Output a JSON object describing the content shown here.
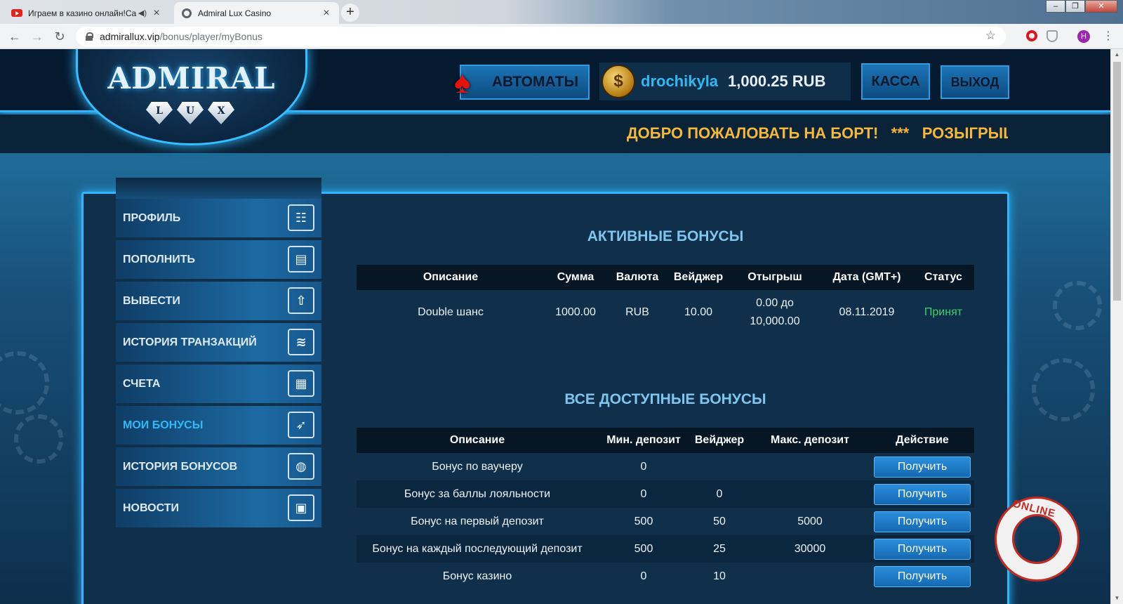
{
  "browser": {
    "tabs": [
      {
        "title": "Играем в казино онлайн!Ca",
        "active": false,
        "icon": "youtube-icon"
      },
      {
        "title": "Admiral Lux Casino",
        "active": true,
        "icon": "globe-icon"
      }
    ],
    "url_host": "admirallux.vip",
    "url_path": "/bonus/player/myBonus",
    "profile_initial": "H"
  },
  "header": {
    "logo_title": "ADMIRAL",
    "logo_sub": [
      "L",
      "U",
      "X"
    ],
    "slots_label": "АВТОМАТЫ",
    "username": "drochikyla",
    "balance": "1,000.25 RUB",
    "cashier_label": "КАССА",
    "exit_label": "ВЫХОД",
    "ticker": "ДОБРО ПОЖАЛОВАТЬ НА БОРТ!   ***   РОЗЫГРЫШ З"
  },
  "sidebar": {
    "items": [
      {
        "label": "ПРОФИЛЬ",
        "icon": "id-card-icon",
        "glyph": "☷"
      },
      {
        "label": "ПОПОЛНИТЬ",
        "icon": "cash-icon",
        "glyph": "▤"
      },
      {
        "label": "ВЫВЕСТИ",
        "icon": "withdraw-icon",
        "glyph": "⇧"
      },
      {
        "label": "ИСТОРИЯ ТРАНЗАКЦИЙ",
        "icon": "transaction-icon",
        "glyph": "≋"
      },
      {
        "label": "СЧЕТА",
        "icon": "accounts-icon",
        "glyph": "▦"
      },
      {
        "label": "МОИ БОНУСЫ",
        "icon": "rocket-icon",
        "glyph": "➶",
        "active": true
      },
      {
        "label": "ИСТОРИЯ БОНУСОВ",
        "icon": "piggy-bank-icon",
        "glyph": "◍"
      },
      {
        "label": "НОВОСТИ",
        "icon": "news-icon",
        "glyph": "▣"
      }
    ]
  },
  "active_bonuses": {
    "heading": "АКТИВНЫЕ БОНУСЫ",
    "columns": [
      "Описание",
      "Сумма",
      "Валюта",
      "Вейджер",
      "Отыгрыш",
      "Дата (GMT+)",
      "Статус"
    ],
    "rows": [
      {
        "description": "Double шанс",
        "amount": "1000.00",
        "currency": "RUB",
        "wager": "10.00",
        "playthrough_1": "0.00 до",
        "playthrough_2": "10,000.00",
        "date": "08.11.2019",
        "status": "Принят"
      }
    ]
  },
  "available_bonuses": {
    "heading": "ВСЕ ДОСТУПНЫЕ БОНУСЫ",
    "columns": [
      "Описание",
      "Мин. депозит",
      "Вейджер",
      "Макс. депозит",
      "Действие"
    ],
    "action_label": "Получить",
    "rows": [
      {
        "description": "Бонус по ваучеру",
        "min_deposit": "0",
        "wager": "",
        "max_deposit": ""
      },
      {
        "description": "Бонус за баллы лояльности",
        "min_deposit": "0",
        "wager": "0",
        "max_deposit": ""
      },
      {
        "description": "Бонус на первый депозит",
        "min_deposit": "500",
        "wager": "50",
        "max_deposit": "5000"
      },
      {
        "description": "Бонус на каждый последующий депозит",
        "min_deposit": "500",
        "wager": "25",
        "max_deposit": "30000"
      },
      {
        "description": "Бонус казино",
        "min_deposit": "0",
        "wager": "10",
        "max_deposit": ""
      }
    ]
  },
  "online_badge": "ONLINE",
  "colors": {
    "accent": "#2fb6ff",
    "status_ok": "#3ccf6a",
    "ticker": "#f5b83a",
    "username": "#30b9f0"
  }
}
